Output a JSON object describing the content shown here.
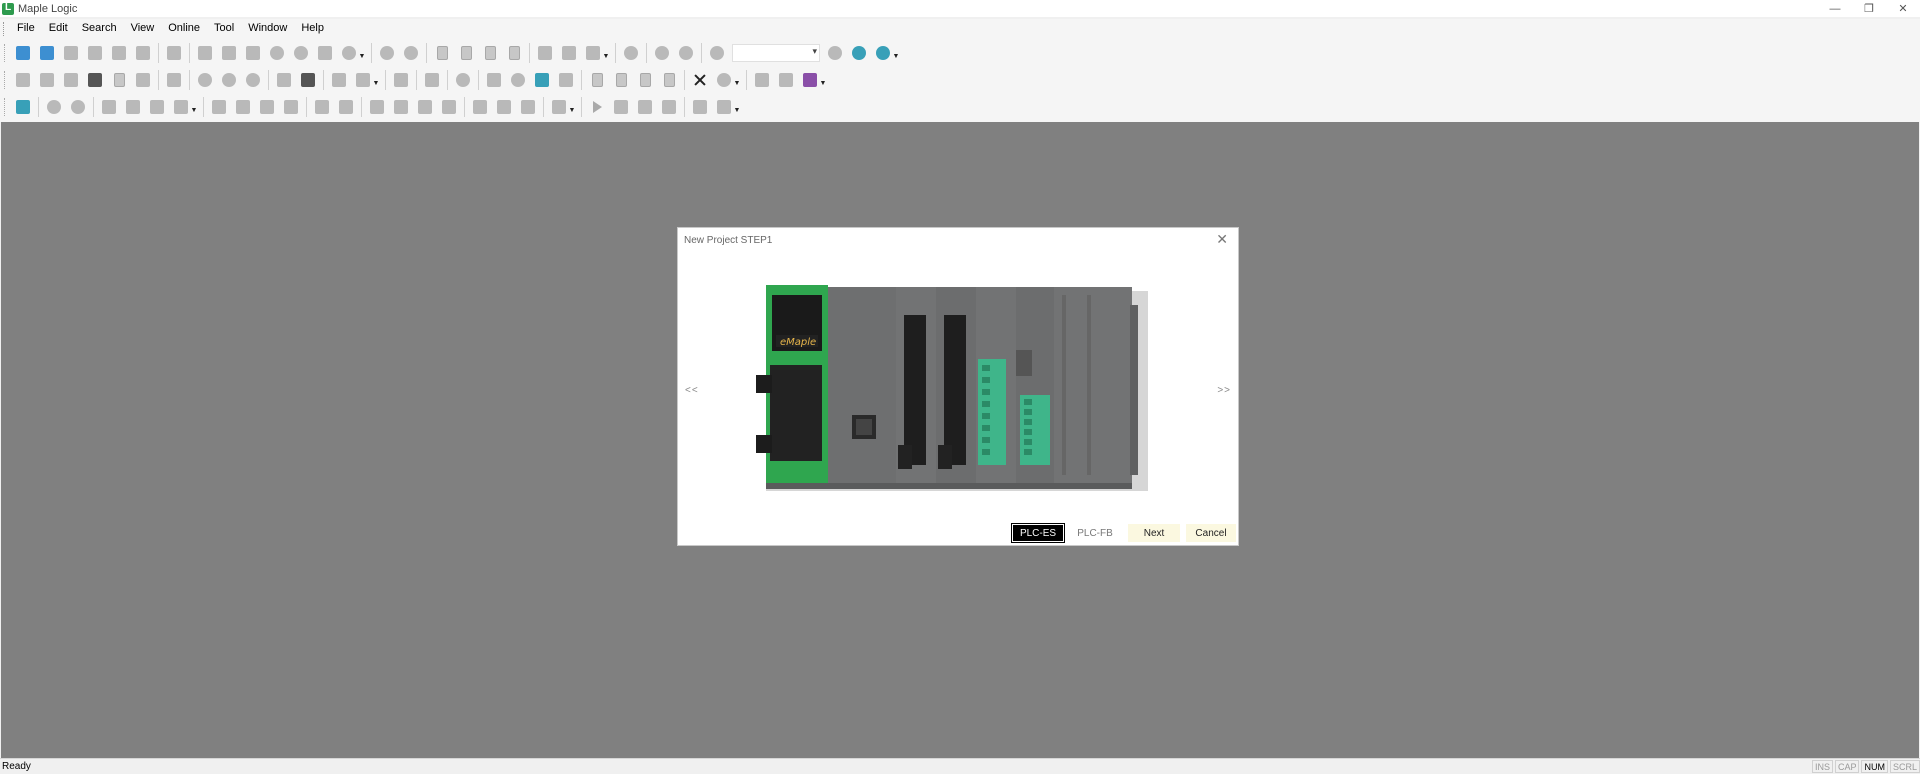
{
  "window": {
    "title": "Maple Logic",
    "controls": {
      "minimize": "—",
      "restore": "❐",
      "close": "✕"
    }
  },
  "menu": {
    "items": [
      "File",
      "Edit",
      "Search",
      "View",
      "Online",
      "Tool",
      "Window",
      "Help"
    ]
  },
  "dialog": {
    "title": "New Project STEP1",
    "close_label": "✕",
    "prev_label": "<<",
    "next_label": ">>",
    "image": {
      "brand": "eMaple"
    },
    "buttons": {
      "plc_es": "PLC-ES",
      "plc_fb": "PLC-FB",
      "next": "Next",
      "cancel": "Cancel"
    }
  },
  "status": {
    "text": "Ready",
    "indicators": [
      {
        "label": "INS",
        "active": false
      },
      {
        "label": "CAP",
        "active": false
      },
      {
        "label": "NUM",
        "active": true
      },
      {
        "label": "SCRL",
        "active": false
      }
    ]
  },
  "colors": {
    "workspace": "#808080",
    "plc_green": "#2fa64f",
    "plc_body": "#6e6f70",
    "terminal_green": "#3fb58a",
    "button_highlight": "#fbf8e0"
  }
}
